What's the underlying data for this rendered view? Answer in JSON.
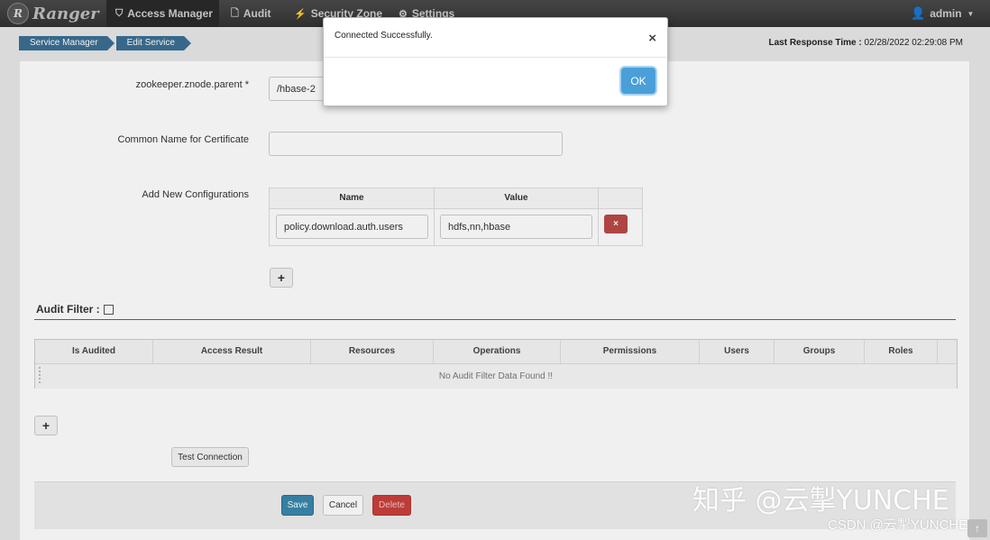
{
  "nav": {
    "brand": "Ranger",
    "logo_letter": "R",
    "items": [
      {
        "label": "Access Manager",
        "icon": "shield-icon"
      },
      {
        "label": "Audit",
        "icon": "file-icon"
      },
      {
        "label": "Security Zone",
        "icon": "zone-icon"
      },
      {
        "label": "Settings",
        "icon": "gear-icon"
      }
    ],
    "user": "admin"
  },
  "breadcrumb": [
    "Service Manager",
    "Edit Service"
  ],
  "last_response": {
    "label": "Last Response Time :",
    "value": "02/28/2022 02:29:08 PM"
  },
  "form": {
    "znode_label": "zookeeper.znode.parent *",
    "znode_value": "/hbase-2",
    "cn_label": "Common Name for Certificate",
    "cn_value": "",
    "add_config_label": "Add New Configurations",
    "config_headers": {
      "name": "Name",
      "value": "Value"
    },
    "config_row": {
      "name": "policy.download.auth.users",
      "value": "hdfs,nn,hbase"
    },
    "remove_symbol": "×",
    "add_symbol": "+"
  },
  "audit": {
    "title": "Audit Filter :",
    "headers": [
      "Is Audited",
      "Access Result",
      "Resources",
      "Operations",
      "Permissions",
      "Users",
      "Groups",
      "Roles"
    ],
    "empty": "No Audit Filter Data Found !!",
    "add_symbol": "+"
  },
  "buttons": {
    "test": "Test Connection",
    "save": "Save",
    "cancel": "Cancel",
    "delete": "Delete"
  },
  "modal": {
    "message": "Connected Successfully.",
    "close": "×",
    "ok": "OK"
  },
  "watermark": {
    "main": "知乎 @云掣YUNCHE",
    "sub": "CSDN @云掣YUNCHE"
  },
  "colors": {
    "nav": "#333333",
    "crumb": "#3b6f93",
    "ok": "#4a9fd8",
    "danger": "#b94a48",
    "save": "#3a87ad"
  }
}
